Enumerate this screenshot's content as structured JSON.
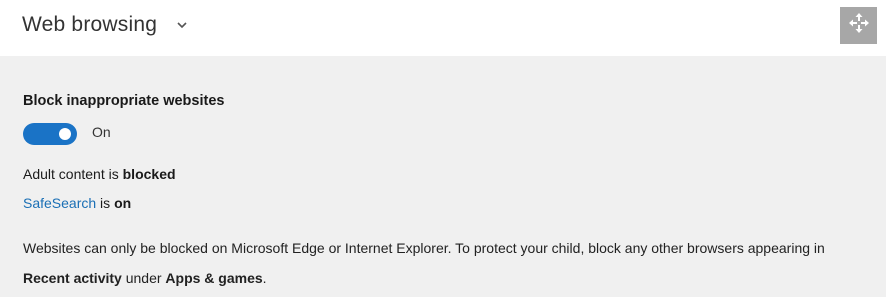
{
  "header": {
    "title": "Web browsing",
    "chevron_icon": "chevron-down-icon",
    "move_icon": "move-arrows-icon"
  },
  "setting": {
    "title": "Block inappropriate websites",
    "toggle_state": "On",
    "toggle_on": true,
    "accent_color": "#1a73c6"
  },
  "status": {
    "adult_prefix": "Adult content is ",
    "adult_value": "blocked",
    "safesearch_link": "SafeSearch",
    "safesearch_mid": " is ",
    "safesearch_value": "on"
  },
  "note": {
    "part1": "Websites can only be blocked on Microsoft Edge or Internet Explorer. To protect your child, block any other browsers appearing in ",
    "recent_activity": "Recent activity",
    "part2": " under ",
    "apps_games": "Apps & games",
    "part3": "."
  }
}
